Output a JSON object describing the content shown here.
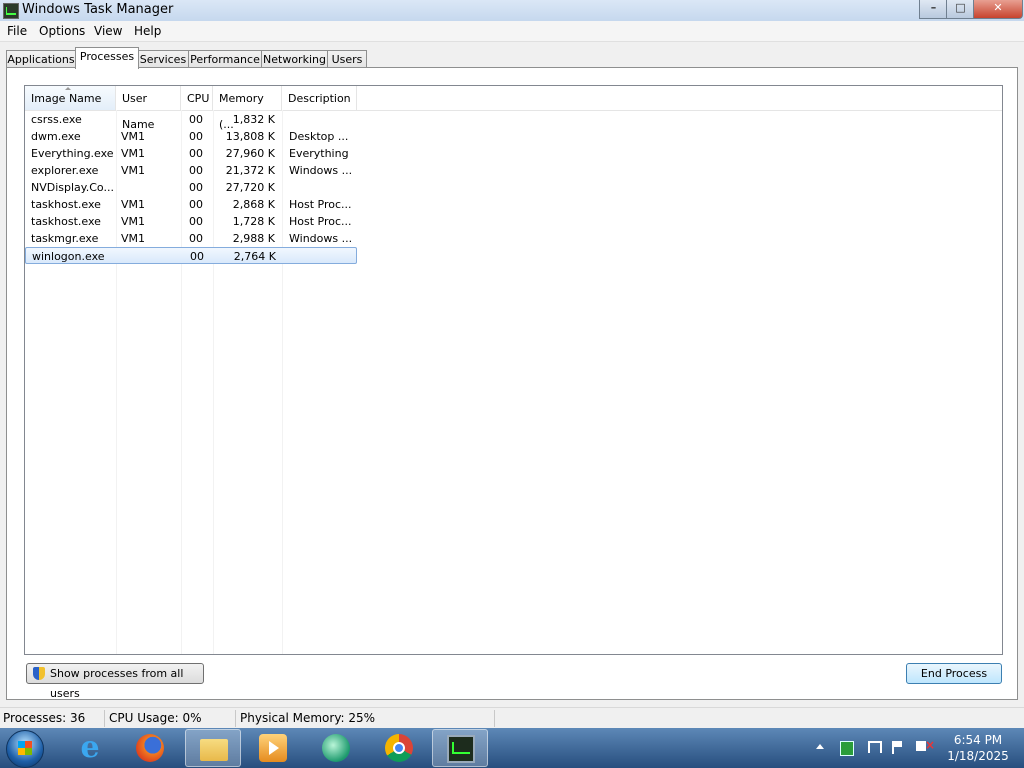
{
  "window": {
    "title": "Windows Task Manager",
    "caption_minimize": "–",
    "caption_maximize": "□",
    "caption_close": "✕"
  },
  "menu": [
    "File",
    "Options",
    "View",
    "Help"
  ],
  "tabs": [
    {
      "label": "Applications",
      "active": false
    },
    {
      "label": "Processes",
      "active": true
    },
    {
      "label": "Services",
      "active": false
    },
    {
      "label": "Performance",
      "active": false
    },
    {
      "label": "Networking",
      "active": false
    },
    {
      "label": "Users",
      "active": false
    }
  ],
  "columns": [
    "Image Name",
    "User Name",
    "CPU",
    "Memory (...",
    "Description"
  ],
  "processes": [
    {
      "name": "csrss.exe",
      "user": "",
      "cpu": "00",
      "memory": "1,832 K",
      "description": ""
    },
    {
      "name": "dwm.exe",
      "user": "VM1",
      "cpu": "00",
      "memory": "13,808 K",
      "description": "Desktop ..."
    },
    {
      "name": "Everything.exe",
      "user": "VM1",
      "cpu": "00",
      "memory": "27,960 K",
      "description": "Everything"
    },
    {
      "name": "explorer.exe",
      "user": "VM1",
      "cpu": "00",
      "memory": "21,372 K",
      "description": "Windows ..."
    },
    {
      "name": "NVDisplay.Co...",
      "user": "",
      "cpu": "00",
      "memory": "27,720 K",
      "description": ""
    },
    {
      "name": "taskhost.exe",
      "user": "VM1",
      "cpu": "00",
      "memory": "2,868 K",
      "description": "Host Proc..."
    },
    {
      "name": "taskhost.exe",
      "user": "VM1",
      "cpu": "00",
      "memory": "1,728 K",
      "description": "Host Proc..."
    },
    {
      "name": "taskmgr.exe",
      "user": "VM1",
      "cpu": "00",
      "memory": "2,988 K",
      "description": "Windows ..."
    },
    {
      "name": "winlogon.exe",
      "user": "",
      "cpu": "00",
      "memory": "2,764 K",
      "description": "",
      "selected": true
    }
  ],
  "buttons": {
    "show_all": "Show processes from all users",
    "end_process": "End Process"
  },
  "status": {
    "processes": "Processes: 36",
    "cpu": "CPU Usage: 0%",
    "memory": "Physical Memory: 25%"
  },
  "taskbar": {
    "ie_glyph": "e",
    "apps": [
      "start-orb",
      "internet-explorer-icon",
      "firefox-icon",
      "windows-explorer-icon",
      "media-player-icon",
      "windows-media-center-icon",
      "chrome-icon",
      "task-manager-icon"
    ]
  },
  "clock": {
    "time": "6:54 PM",
    "date": "1/18/2025"
  },
  "colors": {
    "selection": "#d9e9fb",
    "taskbar": "#274e7e",
    "close_button": "#c7432e"
  }
}
